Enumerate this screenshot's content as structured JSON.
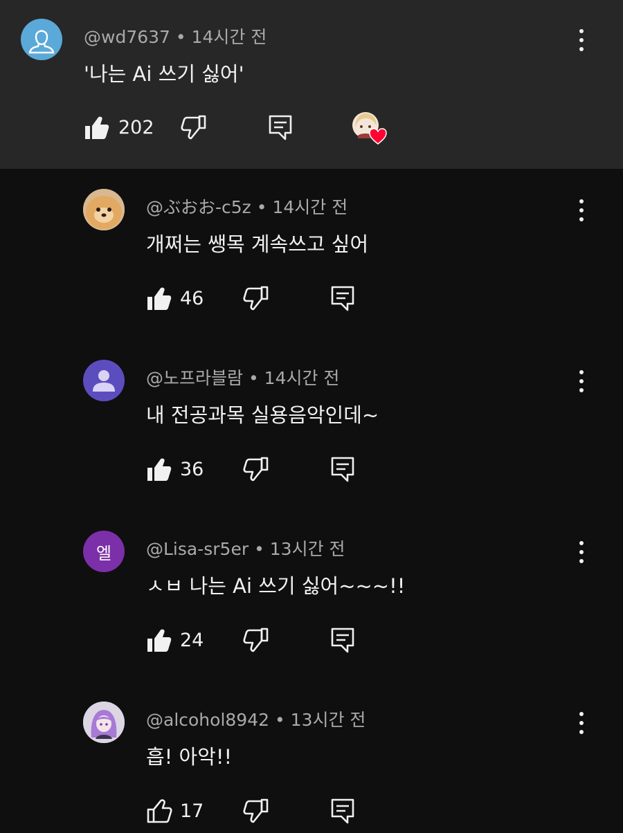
{
  "parent": {
    "handle": "@wd7637",
    "time": "14시간 전",
    "text": "'나는 Ai 쓰기 싫어'",
    "likes": "202",
    "avatar_color": "#5aa9d9",
    "creator_heart": true
  },
  "replies": [
    {
      "handle": "@ぶおお-c5z",
      "time": "14시간 전",
      "text": "개쩌는 쌩목 계속쓰고 싶어",
      "likes": "46",
      "avatar": "dog-photo-avatar",
      "liked": true
    },
    {
      "handle": "@노프라블람",
      "time": "14시간 전",
      "text": "내 전공과목 실용음악인데~",
      "likes": "36",
      "avatar": "default-person-avatar",
      "avatar_color": "#5c4dbf",
      "liked": true
    },
    {
      "handle": "@Lisa-sr5er",
      "time": "13시간 전",
      "text": "ㅅㅂ 나는 Ai 쓰기 싫어~~~!!",
      "likes": "24",
      "avatar_letter": "엘",
      "avatar_color": "#7b2fa8",
      "liked": true
    },
    {
      "handle": "@alcohol8942",
      "time": "13시간 전",
      "text": "흡! 아악!!",
      "likes": "17",
      "avatar": "anime-girl-avatar",
      "liked": false
    }
  ],
  "separator": "•",
  "colors": {
    "background": "#0f0f0f",
    "highlight": "#272727",
    "text": "#f1f1f1",
    "meta": "#aaaaaa",
    "heart": "#ff0033"
  }
}
